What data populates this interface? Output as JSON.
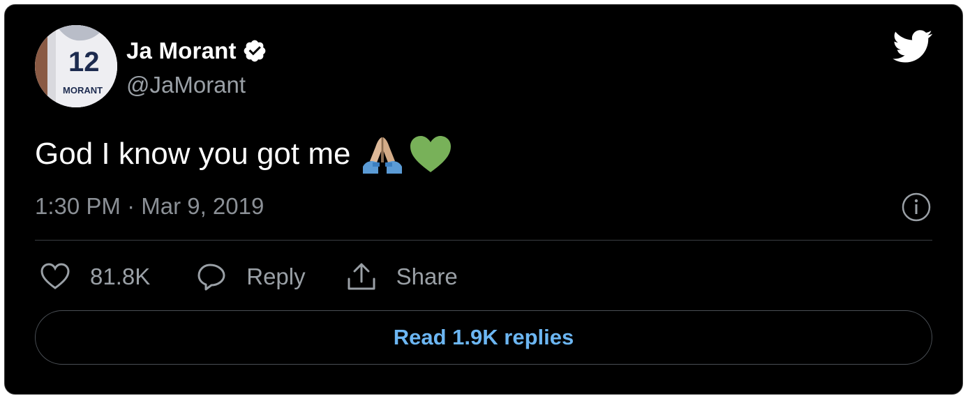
{
  "tweet": {
    "author": {
      "display_name": "Ja Morant",
      "handle": "@JaMorant",
      "verified": true,
      "avatar": {
        "jersey_number": "12",
        "jersey_name": "MORANT"
      }
    },
    "text": "God I know you got me",
    "emojis": [
      "folded-hands-emoji",
      "green-heart-emoji"
    ],
    "timestamp": "1:30 PM · Mar 9, 2019",
    "actions": {
      "like_count": "81.8K",
      "reply_label": "Reply",
      "share_label": "Share"
    },
    "read_replies_label": "Read 1.9K replies"
  },
  "colors": {
    "background": "#000000",
    "text": "#ffffff",
    "muted": "#9aa0a6",
    "link": "#6cb6f2",
    "verified_badge": "#ffffff",
    "green_heart": "#78b159"
  }
}
